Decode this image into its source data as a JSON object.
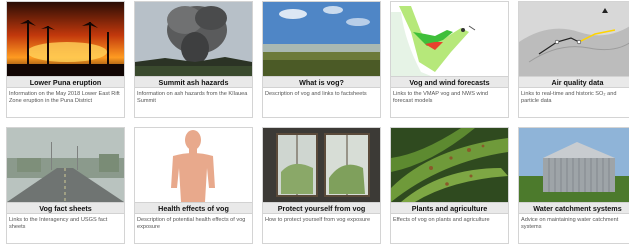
{
  "cards": [
    {
      "title": "Lower Puna eruption",
      "desc": "Information on the May 2018 Lower East Rift Zone eruption in the Puna District"
    },
    {
      "title": "Summit ash hazards",
      "desc": "Information on ash hazards from the Kīlauea Summit"
    },
    {
      "title": "What is vog?",
      "desc": "Description of vog and links to factsheets"
    },
    {
      "title": "Vog and wind forecasts",
      "desc": "Links to the VMAP vog and NWS wind forecast models"
    },
    {
      "title": "Air quality data",
      "desc": "Links to real-time and historic SO₂ and particle data"
    },
    {
      "title": "Vog fact sheets",
      "desc": "Links to the Interagency and USGS fact sheets"
    },
    {
      "title": "Health effects of vog",
      "desc": "Description of potential health effects of vog exposure"
    },
    {
      "title": "Protect yourself from vog",
      "desc": "How to protect yourself from vog exposure"
    },
    {
      "title": "Plants and agriculture",
      "desc": "Effects of vog on plants and agriculture"
    },
    {
      "title": "Water catchment systems",
      "desc": "Advice on maintaining water catchment systems"
    }
  ]
}
